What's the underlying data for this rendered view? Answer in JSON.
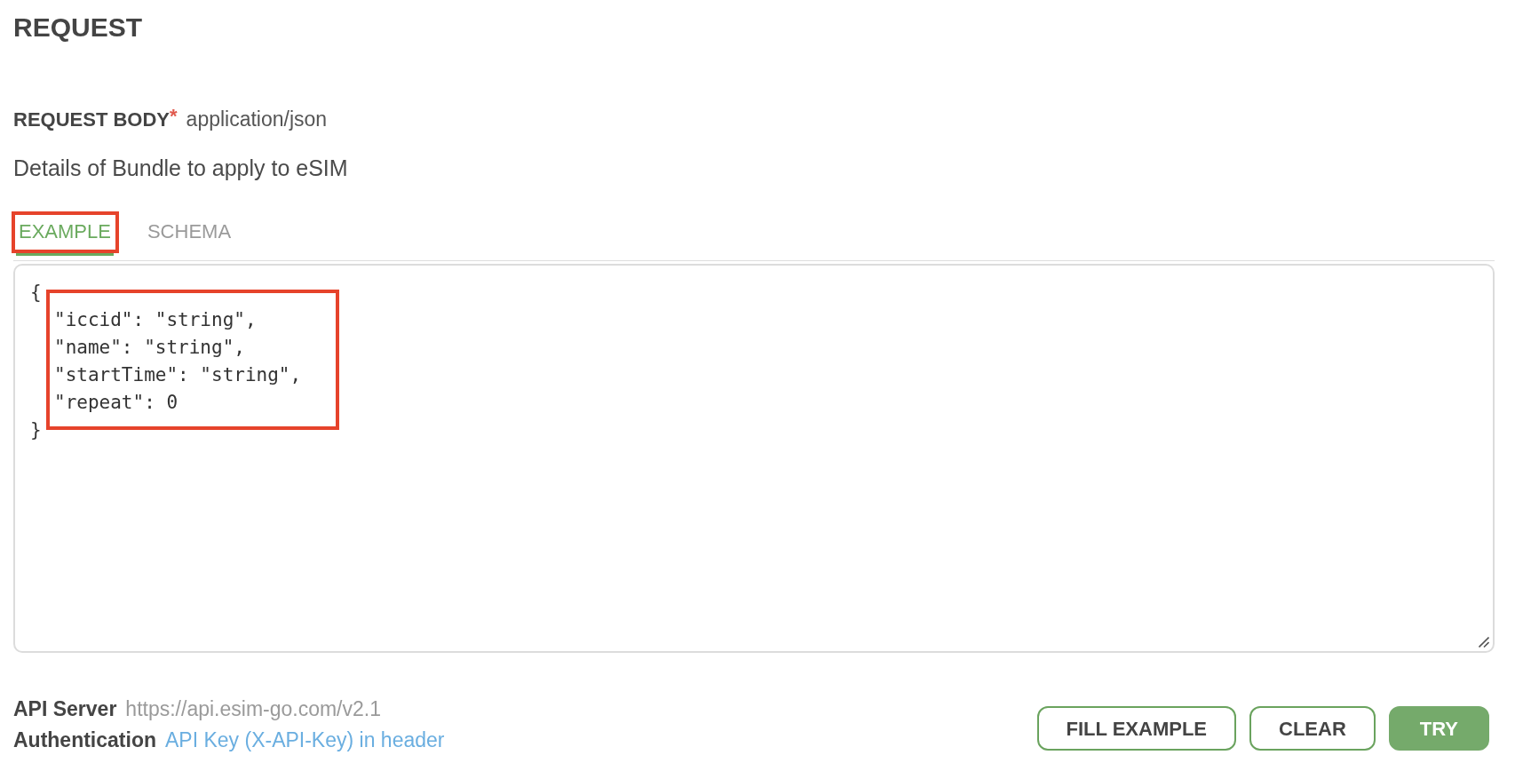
{
  "title": "REQUEST",
  "request_body": {
    "label": "REQUEST BODY",
    "required_mark": "*",
    "content_type": "application/json",
    "description": "Details of Bundle to apply to eSIM"
  },
  "tabs": [
    {
      "label": "EXAMPLE",
      "selected": true,
      "annotated": true
    },
    {
      "label": "SCHEMA",
      "selected": false,
      "annotated": false
    }
  ],
  "editor": {
    "open": "{",
    "entries": [
      {
        "text": "\"iccid\": \"string\",",
        "annotated": true
      },
      {
        "text": "\"name\": \"string\",",
        "annotated": true
      },
      {
        "text": "\"startTime\": \"string\",",
        "annotated": true
      },
      {
        "text": "\"repeat\": 0",
        "annotated": true
      }
    ],
    "close": "}"
  },
  "footer": {
    "items": [
      {
        "label": "API Server",
        "value": "https://api.esim-go.com/v2.1",
        "kind": "text"
      },
      {
        "label": "Authentication",
        "value": "API Key (X-API-Key) in header",
        "kind": "link"
      }
    ]
  },
  "buttons": [
    {
      "label": "FILL EXAMPLE",
      "kind": "outline"
    },
    {
      "label": "CLEAR",
      "kind": "outline"
    },
    {
      "label": "TRY",
      "kind": "primary"
    }
  ]
}
